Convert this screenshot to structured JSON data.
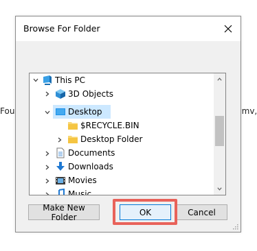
{
  "background": {
    "left_text": "Foun",
    "right_text": ".wmv,"
  },
  "dialog": {
    "title": "Browse For Folder",
    "close_icon": "close-icon",
    "tree": [
      {
        "label": "This PC",
        "icon": "this-pc-icon",
        "expander": "expanded"
      },
      {
        "label": "3D Objects",
        "icon": "3d-objects-icon",
        "expander": "collapsed"
      },
      {
        "label": "Desktop",
        "icon": "desktop-icon",
        "expander": "expanded",
        "selected": true
      },
      {
        "label": "$RECYCLE.BIN",
        "icon": "folder-icon",
        "expander": "none"
      },
      {
        "label": "Desktop Folder",
        "icon": "folder-icon",
        "expander": "collapsed"
      },
      {
        "label": "Documents",
        "icon": "documents-icon",
        "expander": "collapsed"
      },
      {
        "label": "Downloads",
        "icon": "downloads-icon",
        "expander": "collapsed"
      },
      {
        "label": "Movies",
        "icon": "movies-icon",
        "expander": "collapsed"
      },
      {
        "label": "Music",
        "icon": "music-icon",
        "expander": "collapsed"
      }
    ],
    "buttons": {
      "make_new_folder": "Make New Folder",
      "ok": "OK",
      "cancel": "Cancel"
    }
  },
  "colors": {
    "highlight": "#e8625a",
    "selection": "#cce8ff",
    "folder": "#f5c542",
    "accent": "#0078d7"
  }
}
